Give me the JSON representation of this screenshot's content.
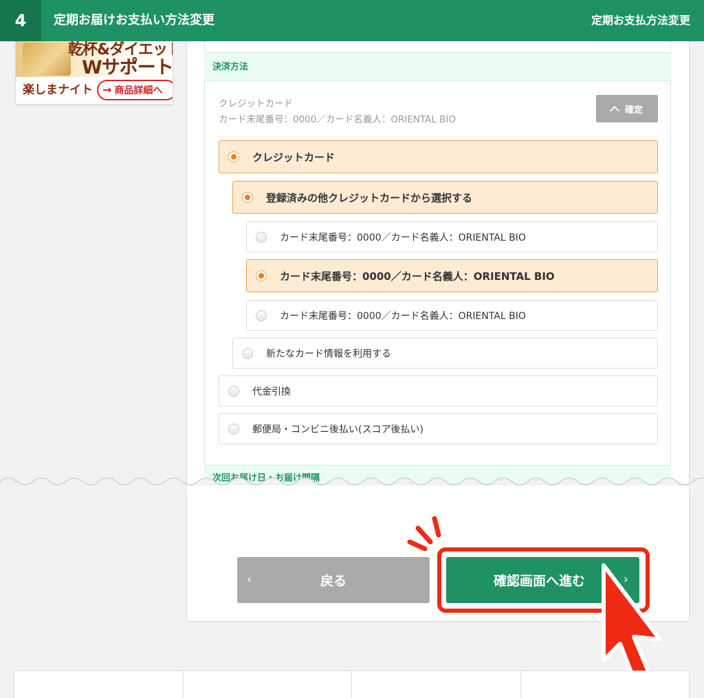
{
  "step": {
    "number": "4",
    "title": "定期お届けお支払い方法変更",
    "right_label": "定期お支払方法変更"
  },
  "banner": {
    "line1": "乾杯&ダイエット",
    "line2": "Wサポート",
    "sub": "楽しまナイト",
    "button": "商品詳細へ"
  },
  "payment": {
    "section_title": "決済方法",
    "current_method_name": "クレジットカード",
    "current_method_detail": "カード末尾番号：0000／カード名義人：ORIENTAL BIO",
    "confirm_label": "確定",
    "options": {
      "credit": "クレジットカード",
      "registered_other": "登録済みの他クレジットカードから選択する",
      "card1": "カード末尾番号：0000／カード名義人：ORIENTAL BIO",
      "card2": "カード末尾番号：0000／カード名義人：ORIENTAL BIO",
      "card3": "カード末尾番号：0000／カード名義人：ORIENTAL BIO",
      "new_card": "新たなカード情報を利用する",
      "cod": "代金引換",
      "post_pay": "郵便局・コンビニ後払い(スコア後払い)"
    },
    "next_section_title": "次回お届け日・お届け間隔"
  },
  "buttons": {
    "back": "戻る",
    "next": "確認画面へ進む"
  },
  "colors": {
    "brand_green": "#1e9263",
    "selected_bg": "#fdebd4",
    "accent_red": "#ee2a12"
  }
}
